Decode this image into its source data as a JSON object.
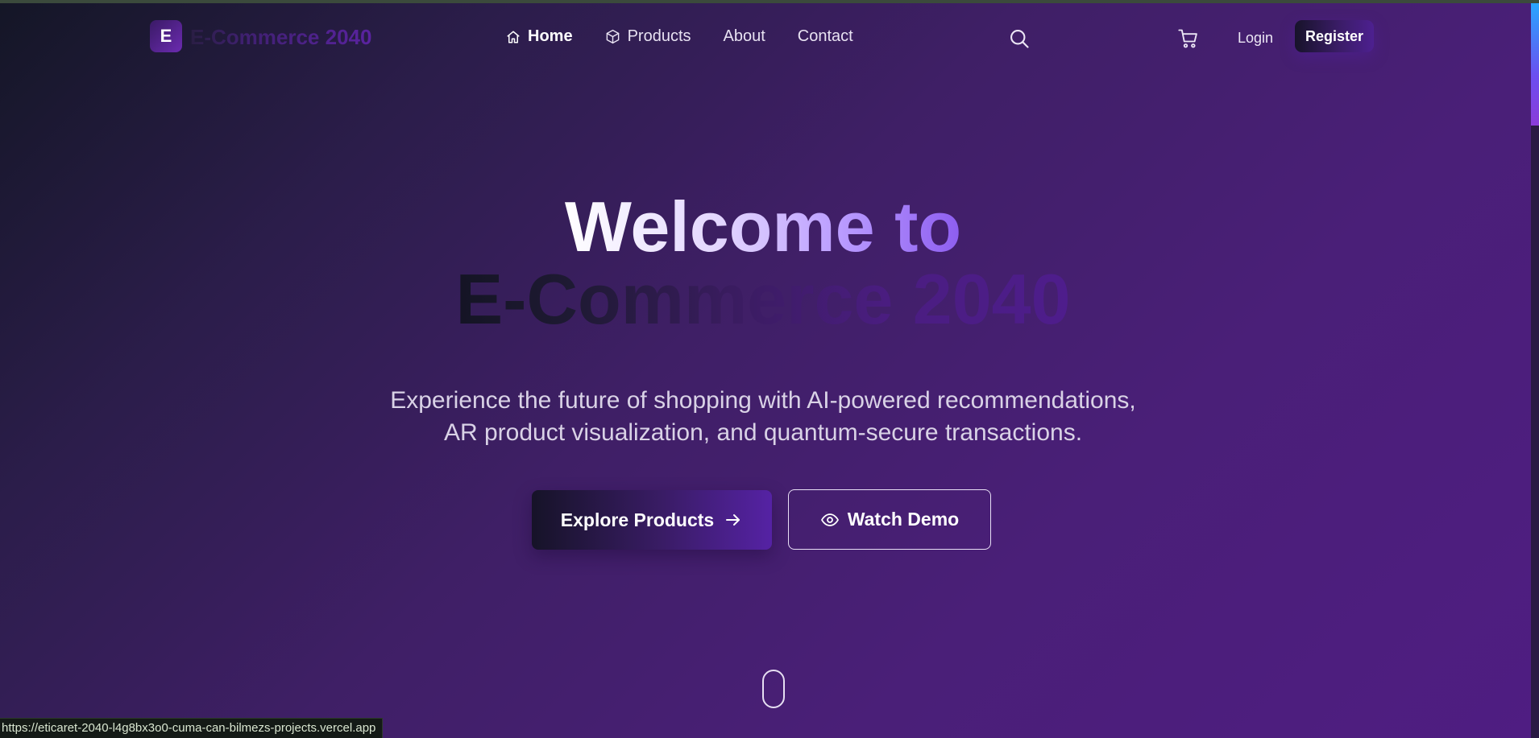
{
  "header": {
    "logo_letter": "E",
    "logo_text": "E-Commerce 2040",
    "nav": [
      {
        "label": "Home",
        "icon": "home-icon"
      },
      {
        "label": "Products",
        "icon": "cube-icon"
      },
      {
        "label": "About"
      },
      {
        "label": "Contact"
      }
    ],
    "login_label": "Login",
    "register_label": "Register"
  },
  "hero": {
    "title_line1": "Welcome to",
    "title_line2": "E-Commerce 2040",
    "subtitle": "Experience the future of shopping with AI-powered recommendations, AR product visualization, and quantum-secure transactions.",
    "explore_label": "Explore Products",
    "demo_label": "Watch Demo"
  },
  "status_bar": {
    "url": "https://eticaret-2040-l4g8bx3o0-cuma-can-bilmezs-projects.vercel.app"
  },
  "icons": {
    "search": "search-icon",
    "cart": "cart-icon",
    "arrow": "arrow-right-icon",
    "eye": "eye-icon",
    "scroll": "scroll-mouse-icon"
  },
  "colors": {
    "background_start": "#141626",
    "background_end": "#4f1d82",
    "accent": "#6b2bb0",
    "title_highlight": "#8d5df0"
  }
}
